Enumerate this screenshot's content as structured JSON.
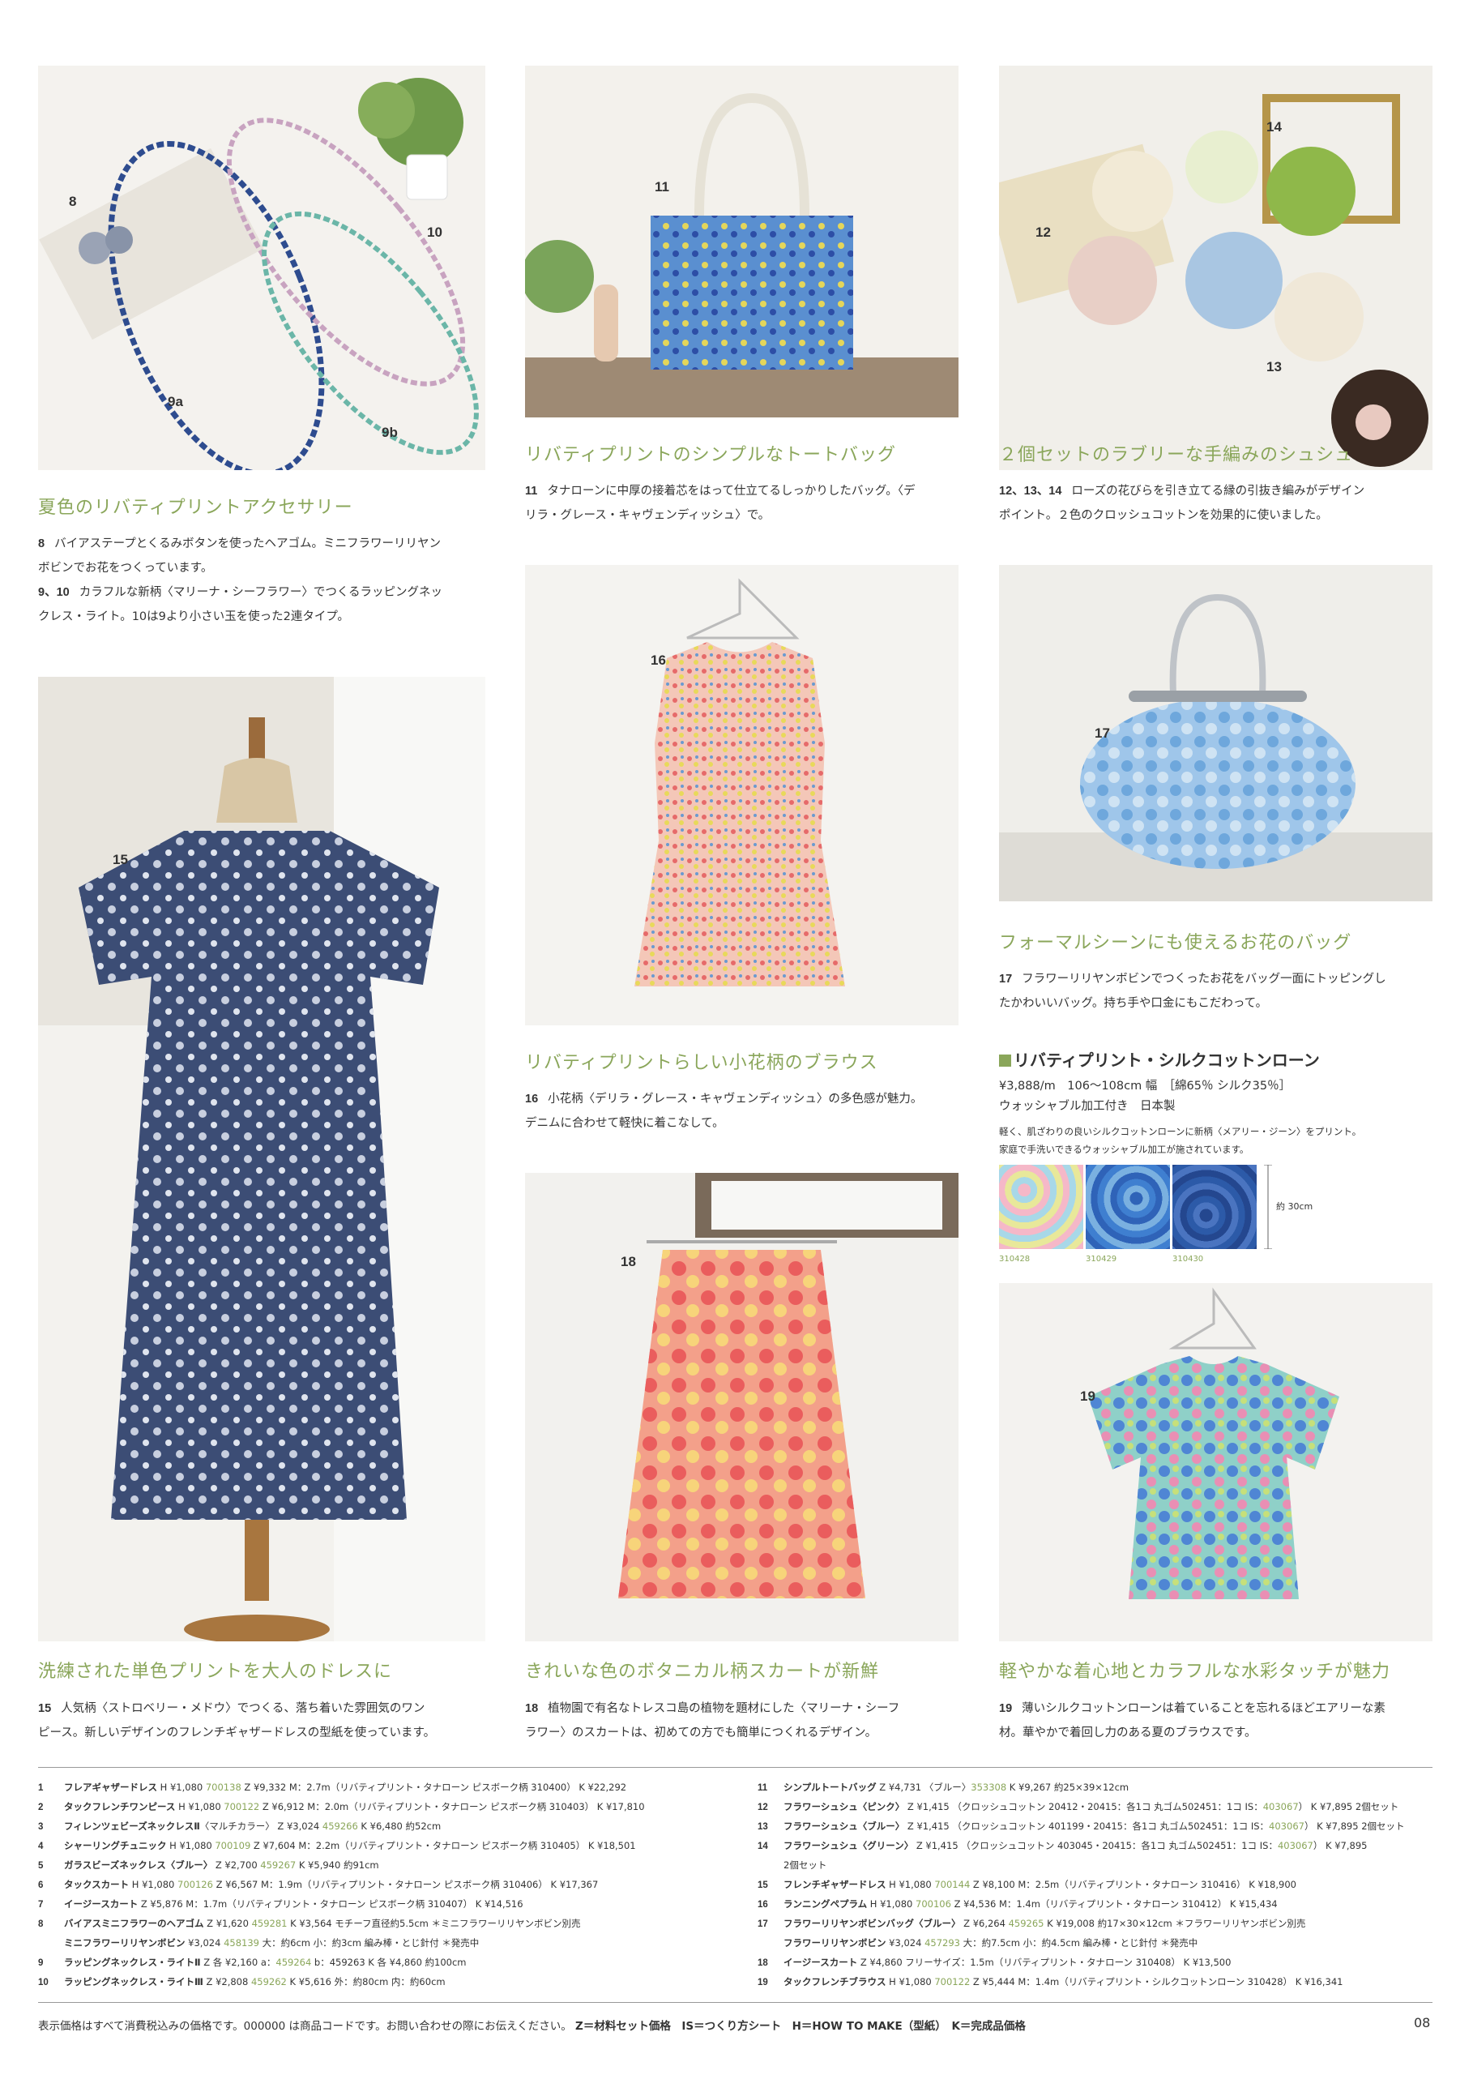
{
  "photos": {
    "p1": {
      "labels": [
        "8",
        "10",
        "9a",
        "9b"
      ]
    },
    "p2": {
      "labels": [
        "11"
      ]
    },
    "p3": {
      "labels": [
        "14",
        "12",
        "13"
      ]
    },
    "p4": {
      "labels": [
        "15"
      ]
    },
    "p5": {
      "labels": [
        "16"
      ]
    },
    "p6": {
      "labels": [
        "17"
      ]
    },
    "p7": {
      "labels": [
        "18"
      ]
    },
    "p8": {
      "labels": [
        "19"
      ]
    }
  },
  "sections": {
    "accessories": {
      "title": "夏色のリバティプリントアクセサリー",
      "lines": [
        {
          "num": "8",
          "text": "バイアステープとくるみボタンを使ったヘアゴム。ミニフラワーリリヤン"
        },
        {
          "num": "",
          "text": "ボビンでお花をつくっています。"
        },
        {
          "num": "9、10",
          "text": "カラフルな新柄〈マリーナ・シーフラワー〉でつくるラッピングネッ"
        },
        {
          "num": "",
          "text": "クレス・ライト。10は9より小さい玉を使った2連タイプ。"
        }
      ]
    },
    "tote": {
      "title": "リバティプリントのシンプルなトートバッグ",
      "lines": [
        {
          "num": "11",
          "text": "タナローンに中厚の接着芯をはって仕立てるしっかりしたバッグ。〈デ"
        },
        {
          "num": "",
          "text": "リラ・グレース・キャヴェンディッシュ〉で。"
        }
      ]
    },
    "scrunchie": {
      "title": "２個セットのラブリーな手編みのシュシュ",
      "lines": [
        {
          "num": "12、13、14",
          "text": "ローズの花びらを引き立てる縁の引抜き編みがデザイン"
        },
        {
          "num": "",
          "text": "ポイント。２色のクロッシュコットンを効果的に使いました。"
        }
      ]
    },
    "blouse16": {
      "title": "リバティプリントらしい小花柄のブラウス",
      "lines": [
        {
          "num": "16",
          "text": "小花柄〈デリラ・グレース・キャヴェンディッシュ〉の多色感が魅力。"
        },
        {
          "num": "",
          "text": "デニムに合わせて軽快に着こなして。"
        }
      ]
    },
    "bag17": {
      "title": "フォーマルシーンにも使えるお花のバッグ",
      "lines": [
        {
          "num": "17",
          "text": "フラワーリリヤンボビンでつくったお花をバッグ一面にトッピングし"
        },
        {
          "num": "",
          "text": "たかわいいバッグ。持ち手や口金にもこだわって。"
        }
      ]
    },
    "dress": {
      "title": "洗練された単色プリントを大人のドレスに",
      "lines": [
        {
          "num": "15",
          "text": "人気柄〈ストロベリー・メドウ〉でつくる、落ち着いた雰囲気のワン"
        },
        {
          "num": "",
          "text": "ピース。新しいデザインのフレンチギャザードレスの型紙を使っています。"
        }
      ]
    },
    "skirt": {
      "title": "きれいな色のボタニカル柄スカートが新鮮",
      "lines": [
        {
          "num": "18",
          "text": "植物園で有名なトレスコ島の植物を題材にした〈マリーナ・シーフ"
        },
        {
          "num": "",
          "text": "ラワー〉のスカートは、初めての方でも簡単につくれるデザイン。"
        }
      ]
    },
    "blouse19": {
      "title": "軽やかな着心地とカラフルな水彩タッチが魅力",
      "lines": [
        {
          "num": "19",
          "text": "薄いシルクコットンローンは着ていることを忘れるほどエアリーな素"
        },
        {
          "num": "",
          "text": "材。華やかで着回し力のある夏のブラウスです。"
        }
      ]
    }
  },
  "fabric": {
    "title": "リバティプリント・シルクコットンローン",
    "price_line": "¥3,888/m　106～108cm 幅　［綿65％ シルク35％］",
    "feature_line": "ウォッシャブル加工付き　日本製",
    "note1": "軽く、肌ざわりの良いシルクコットンローンに新柄〈メアリー・ジーン〉をプリント。",
    "note2": "家庭で手洗いできるウォッシャブル加工が施されています。",
    "size_label": "約 30cm",
    "swatches": [
      {
        "code": "310428",
        "color": "#d9e6a8"
      },
      {
        "code": "310429",
        "color": "#3f6fc4"
      },
      {
        "code": "310430",
        "color": "#2c4f9a"
      }
    ]
  },
  "items_left": [
    {
      "n": "1",
      "name": "フレアギャザードレス",
      "pre": " H ¥1,080 ",
      "code": "700138",
      "post": " Z ¥9,332 M：2.7m（リバティプリント・タナローン ピスボーク柄 310400） K ¥22,292"
    },
    {
      "n": "2",
      "name": "タックフレンチワンピース",
      "pre": " H ¥1,080 ",
      "code": "700122",
      "post": " Z ¥6,912 M：2.0m（リバティプリント・タナローン ピスボーク柄 310403） K ¥17,810"
    },
    {
      "n": "3",
      "name": "フィレンツェビーズネックレスⅡ",
      "pre": "〈マルチカラー〉 Z ¥3,024 ",
      "code": "459266",
      "post": " K ¥6,480 約52cm"
    },
    {
      "n": "4",
      "name": "シャーリングチュニック",
      "pre": " H ¥1,080 ",
      "code": "700109",
      "post": " Z ¥7,604 M：2.2m（リバティプリント・タナローン ピスボーク柄 310405） K ¥18,501"
    },
    {
      "n": "5",
      "name": "ガラスビーズネックレス〈ブルー〉",
      "pre": " Z ¥2,700 ",
      "code": "459267",
      "post": " K ¥5,940 約91cm"
    },
    {
      "n": "6",
      "name": "タックスカート",
      "pre": " H ¥1,080 ",
      "code": "700126",
      "post": " Z ¥6,567 M：1.9m（リバティプリント・タナローン ピスボーク柄 310406） K ¥17,367"
    },
    {
      "n": "7",
      "name": "イージースカート",
      "pre": " Z ¥5,876 M：1.7m（リバティプリント・タナローン ピスボーク柄 310407） K ¥14,516",
      "code": "",
      "post": ""
    },
    {
      "n": "8",
      "name": "バイアスミニフラワーのヘアゴム",
      "pre": " Z ¥1,620 ",
      "code": "459281",
      "post": " K ¥3,564 モチーフ直径約5.5cm ＊ミニフラワーリリヤンボビン別売"
    },
    {
      "n": "",
      "name": "ミニフラワーリリヤンボビン",
      "pre": " ¥3,024 ",
      "code": "458139",
      "post": " 大：約6cm 小：約3cm 編み棒・とじ針付 ＊発売中"
    },
    {
      "n": "9",
      "name": "ラッピングネックレス・ライトⅡ",
      "pre": " Z 各 ¥2,160 a：",
      "code": "459264",
      "post": " b：459263 K 各 ¥4,860 約100cm"
    },
    {
      "n": "10",
      "name": "ラッピングネックレス・ライトⅢ",
      "pre": " Z ¥2,808 ",
      "code": "459262",
      "post": " K ¥5,616 外：約80cm 内：約60cm"
    }
  ],
  "items_right": [
    {
      "n": "11",
      "name": "シンプルトートバッグ",
      "pre": " Z ¥4,731 〈ブルー〉",
      "code": "353308",
      "post": " K ¥9,267 約25×39×12cm"
    },
    {
      "n": "12",
      "name": "フラワーシュシュ〈ピンク〉",
      "pre": " Z ¥1,415 （クロッシュコットン 20412・20415：各1コ 丸ゴム502451：1コ IS：",
      "code": "403067",
      "post": "） K ¥7,895 2個セット"
    },
    {
      "n": "13",
      "name": "フラワーシュシュ〈ブルー〉",
      "pre": " Z ¥1,415 （クロッシュコットン 401199・20415：各1コ 丸ゴム502451：1コ IS：",
      "code": "403067",
      "post": "） K ¥7,895 2個セット"
    },
    {
      "n": "14",
      "name": "フラワーシュシュ〈グリーン〉",
      "pre": " Z ¥1,415 （クロッシュコットン 403045・20415：各1コ 丸ゴム502451：1コ IS：",
      "code": "403067",
      "post": "） K ¥7,895"
    },
    {
      "n": "",
      "name": "",
      "pre": "2個セット",
      "code": "",
      "post": ""
    },
    {
      "n": "15",
      "name": "フレンチギャザードレス",
      "pre": " H ¥1,080 ",
      "code": "700144",
      "post": " Z ¥8,100 M：2.5m（リバティプリント・タナローン 310416） K ¥18,900"
    },
    {
      "n": "16",
      "name": "ランニングペプラム",
      "pre": " H ¥1,080 ",
      "code": "700106",
      "post": " Z ¥4,536 M：1.4m（リバティプリント・タナローン 310412） K ¥15,434"
    },
    {
      "n": "17",
      "name": "フラワーリリヤンボビンバッグ〈ブルー〉",
      "pre": " Z ¥6,264 ",
      "code": "459265",
      "post": " K ¥19,008 約17×30×12cm ＊フラワーリリヤンボビン別売"
    },
    {
      "n": "",
      "name": "フラワーリリヤンボビン",
      "pre": " ¥3,024 ",
      "code": "457293",
      "post": " 大：約7.5cm 小：約4.5cm 編み棒・とじ針付 ＊発売中"
    },
    {
      "n": "18",
      "name": "イージースカート",
      "pre": " Z ¥4,860 フリーサイズ：1.5m（リバティプリント・タナローン 310408） K ¥13,500",
      "code": "",
      "post": ""
    },
    {
      "n": "19",
      "name": "タックフレンチブラウス",
      "pre": " H ¥1,080 ",
      "code": "700122",
      "post": " Z ¥5,444 M：1.4m（リバティプリント・シルクコットンローン 310428） K ¥16,341"
    }
  ],
  "footer": {
    "text": "表示価格はすべて消費税込みの価格です。000000 は商品コードです。お問い合わせの際にお伝えください。",
    "legend": "Z＝材料セット価格　IS＝つくり方シート　H＝HOW TO MAKE（型紙）　K＝完成品価格",
    "page": "08"
  }
}
